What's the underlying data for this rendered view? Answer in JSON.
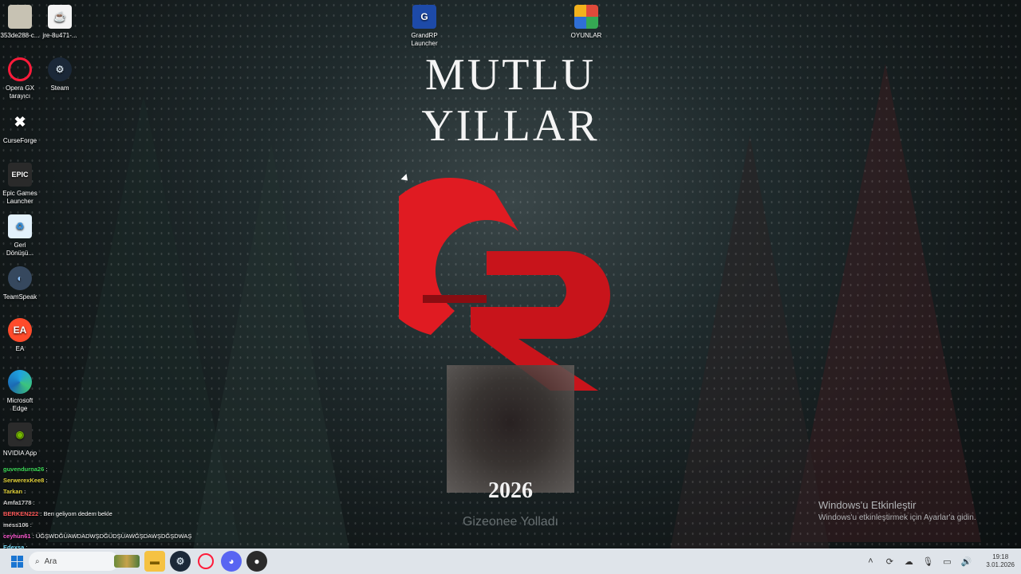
{
  "wallpaper": {
    "title": "MUTLU YILLAR",
    "year": "2026",
    "donation_text": "Gizeonee Yolladı",
    "logo_colors": {
      "primary": "#e01b22",
      "dark": "#8a0d12"
    }
  },
  "desktop_icons": [
    {
      "label": "353de288-c...",
      "icon": "file-icon"
    },
    {
      "label": "jre-8u471-...",
      "icon": "java-icon"
    },
    {
      "label": "Opera GX tarayıcı",
      "icon": "opera-gx-icon"
    },
    {
      "label": "Steam",
      "icon": "steam-icon"
    },
    {
      "label": "CurseForge",
      "icon": "curseforge-icon"
    },
    {
      "label": "Epic Games Launcher",
      "icon": "epic-games-icon"
    },
    {
      "label": "Geri Dönüşü...",
      "icon": "recycle-bin-icon"
    },
    {
      "label": "TeamSpeak",
      "icon": "teamspeak-icon"
    },
    {
      "label": "EA",
      "icon": "ea-icon"
    },
    {
      "label": "Microsoft Edge",
      "icon": "edge-icon"
    },
    {
      "label": "NVIDIA App",
      "icon": "nvidia-icon"
    },
    {
      "label": "GrandRP Launcher",
      "icon": "grandrp-icon"
    },
    {
      "label": "OYUNLAR",
      "icon": "folder-games-icon"
    }
  ],
  "chat": [
    {
      "user": "guvendurna26",
      "message": "",
      "color": "#3fdc5a"
    },
    {
      "user": "SerwerexKee8",
      "message": "",
      "color": "#e3d23a"
    },
    {
      "user": "Tarkan",
      "message": "",
      "color": "#e3d23a"
    },
    {
      "user": "Amfa1778",
      "message": "",
      "color": "#cfcfcf"
    },
    {
      "user": "BERKEN222",
      "message": "Ben geliyom dedem bekle",
      "color": "#ff5a5a"
    },
    {
      "user": "mess106",
      "message": "",
      "color": "#cfcfcf"
    },
    {
      "user": "ceyhun61",
      "message": "ÜĞŞWDĞÜAWDADWŞDĞÜDŞÜAWĞŞDAWŞDĞŞDWAŞ",
      "color": "#ff5ad2"
    },
    {
      "user": "Edexsa",
      "message": "",
      "color": "#7be0ff"
    }
  ],
  "activation": {
    "title": "Windows'u Etkinleştir",
    "subtitle": "Windows'u etkinleştirmek için Ayarlar'a gidin."
  },
  "taskbar": {
    "search_placeholder": "Ara",
    "apps": [
      "file-explorer-icon",
      "steam-icon",
      "opera-gx-icon",
      "discord-icon",
      "obs-icon"
    ],
    "time": "19:18",
    "date": "3.01.2026"
  }
}
